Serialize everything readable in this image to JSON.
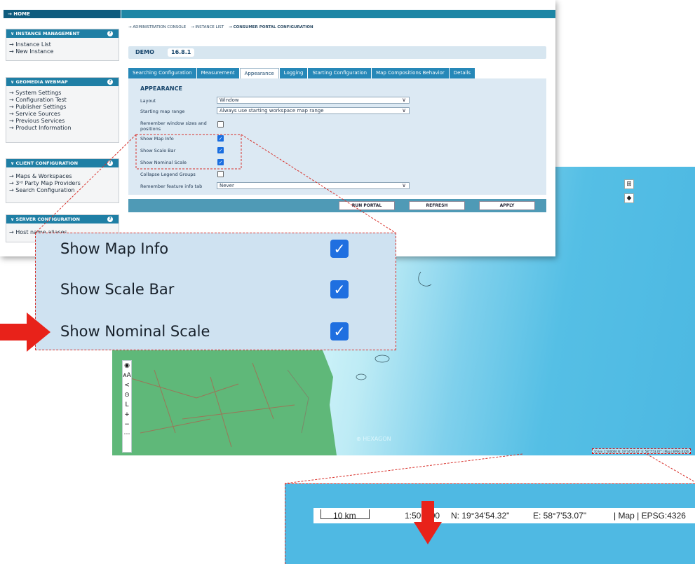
{
  "sidebar": {
    "home": "→ HOME",
    "sections": [
      {
        "title": "∨ INSTANCE MANAGEMENT",
        "items": [
          "→ Instance List",
          "→ New Instance"
        ]
      },
      {
        "title": "∨ GEOMEDIA WEBMAP",
        "items": [
          "→ System Settings",
          "→ Configuration Test",
          "→ Publisher Settings",
          "→ Service Sources",
          "→ Previous Services",
          "→ Product Information"
        ]
      },
      {
        "title": "∨ CLIENT CONFIGURATION",
        "items": [
          "→ Maps & Workspaces",
          "→ 3ʳᵈ Party Map Providers",
          "→ Search Configuration"
        ]
      },
      {
        "title": "∨ SERVER CONFIGURATION",
        "items": [
          "→ Host name aliases"
        ]
      }
    ],
    "help_glyph": "?"
  },
  "breadcrumb": {
    "a": "→ ADMINISTRATION CONSOLE",
    "b": "→ INSTANCE LIST",
    "c": "→ CONSUMER PORTAL CONFIGURATION"
  },
  "instance": {
    "name": "DEMO",
    "version": "16.8.1"
  },
  "tabs": [
    "Searching Configuration",
    "Measurement",
    "Appearance",
    "Logging",
    "Starting Configuration",
    "Map Compositions Behavior",
    "Details"
  ],
  "active_tab": "Appearance",
  "appearance": {
    "heading": "APPEARANCE",
    "layout_label": "Layout",
    "layout_value": "Window",
    "range_label": "Starting map range",
    "range_value": "Always use starting workspace map range",
    "remember_label": "Remember window sizes and positions",
    "map_info_label": "Show Map Info",
    "scale_bar_label": "Show Scale Bar",
    "nominal_label": "Show Nominal Scale",
    "collapse_label": "Collapse Legend Groups",
    "feature_tab_label": "Remember feature info tab",
    "feature_tab_value": "Never"
  },
  "actions": {
    "run": "RUN PORTAL",
    "refresh": "REFRESH",
    "apply": "APPLY"
  },
  "map": {
    "tools": [
      "◉",
      "ᴀA",
      "<",
      "⊙",
      "L",
      "+",
      "−",
      "⋯"
    ],
    "mini_status": "10 km   1:500000  N: 19°34'54.32\"   E: 58°7'53.07\"   | Map | EPSG:4326",
    "watermark": "⊕ HEXAGON"
  },
  "zoom_labels": {
    "map_info": "Show Map Info",
    "scale_bar": "Show Scale Bar",
    "nominal": "Show Nominal Scale",
    "check": "✓"
  },
  "status_bar": {
    "scale_bar_text": "10 km",
    "nominal_scale": "1:500000",
    "north": "N: 19°34'54.32\"",
    "east": "E: 58°7'53.07\"",
    "crs": "| Map | EPSG:4326"
  }
}
